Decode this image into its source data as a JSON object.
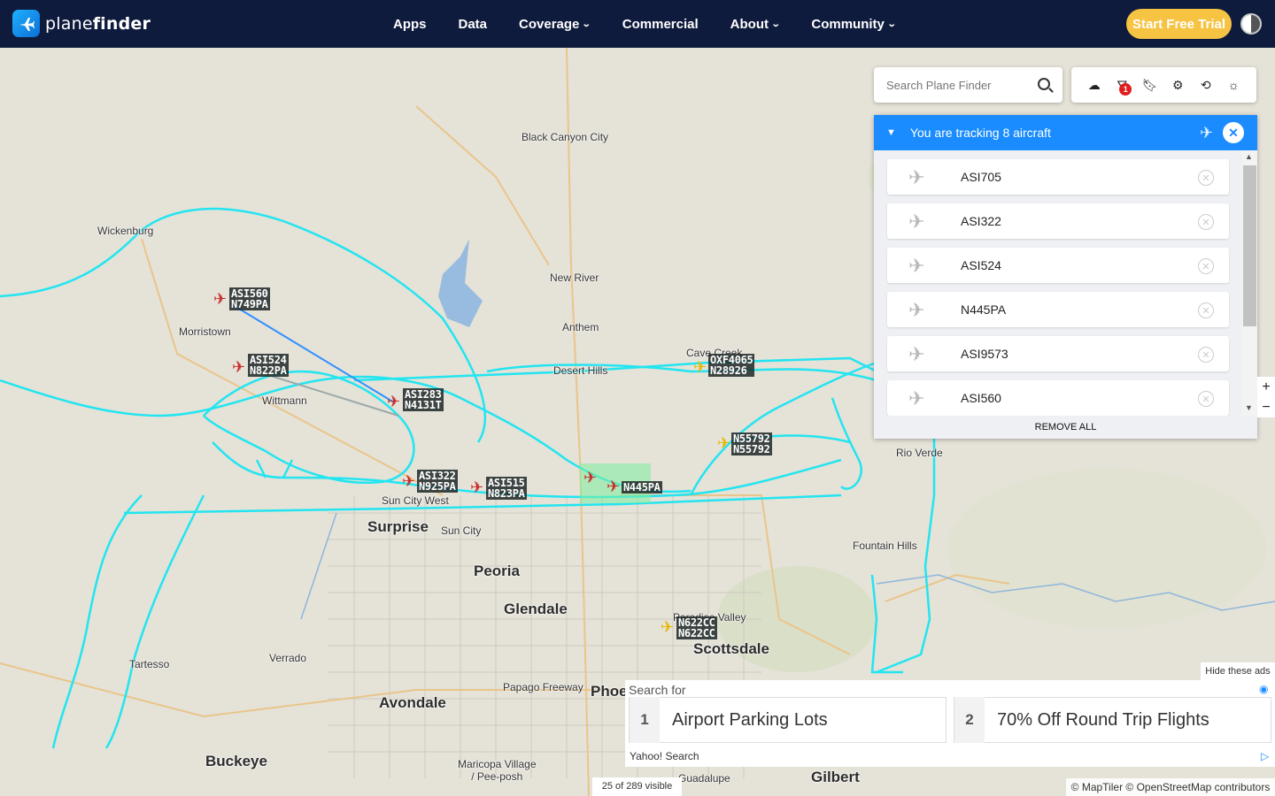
{
  "header": {
    "logo_plane": "plane",
    "logo_finder": "finder",
    "nav": [
      {
        "label": "Apps",
        "dropdown": false
      },
      {
        "label": "Data",
        "dropdown": false
      },
      {
        "label": "Coverage",
        "dropdown": true
      },
      {
        "label": "Commercial",
        "dropdown": false
      },
      {
        "label": "About",
        "dropdown": true
      },
      {
        "label": "Community",
        "dropdown": true
      }
    ],
    "cta": "Start Free Trial"
  },
  "search": {
    "placeholder": "Search Plane Finder"
  },
  "toolbar": {
    "icons": [
      "cloud-icon",
      "filter-icon",
      "bookmark-icon",
      "settings-icon",
      "history-icon",
      "weather-icon"
    ],
    "filter_badge": "1"
  },
  "tracking": {
    "title": "You are tracking 8 aircraft",
    "items": [
      "ASI705",
      "ASI322",
      "ASI524",
      "N445PA",
      "ASI9573",
      "ASI560"
    ],
    "remove_all": "REMOVE ALL"
  },
  "map": {
    "places": [
      {
        "name": "Black Canyon City",
        "type": "town"
      },
      {
        "name": "Wickenburg",
        "type": "town"
      },
      {
        "name": "New River",
        "type": "town"
      },
      {
        "name": "Anthem",
        "type": "town"
      },
      {
        "name": "Morristown",
        "type": "town"
      },
      {
        "name": "Cave Creek",
        "type": "town"
      },
      {
        "name": "Desert Hills",
        "type": "town"
      },
      {
        "name": "Rio Verde",
        "type": "town"
      },
      {
        "name": "Sun City West",
        "type": "town"
      },
      {
        "name": "Surprise",
        "type": "city"
      },
      {
        "name": "Sun City",
        "type": "town"
      },
      {
        "name": "Fountain Hills",
        "type": "town"
      },
      {
        "name": "Peoria",
        "type": "city"
      },
      {
        "name": "Glendale",
        "type": "city"
      },
      {
        "name": "Paradise Valley",
        "type": "town"
      },
      {
        "name": "Scottsdale",
        "type": "city"
      },
      {
        "name": "Tartesso",
        "type": "town"
      },
      {
        "name": "Verrado",
        "type": "town"
      },
      {
        "name": "Papago Freeway",
        "type": "town"
      },
      {
        "name": "Phoe",
        "type": "city"
      },
      {
        "name": "Avondale",
        "type": "city"
      },
      {
        "name": "Buckeye",
        "type": "city"
      },
      {
        "name": "Maricopa Village\n/ Pee-posh",
        "type": "town"
      },
      {
        "name": "Guadalupe",
        "type": "town"
      },
      {
        "name": "Gilbert",
        "type": "city"
      },
      {
        "name": "Wittmann",
        "type": "town"
      }
    ],
    "aircraft": [
      {
        "callsign": "ASI560",
        "reg": "N749PA",
        "color": "red"
      },
      {
        "callsign": "ASI524",
        "reg": "N822PA",
        "color": "red"
      },
      {
        "callsign": "ASI283",
        "reg": "N4131T",
        "color": "red"
      },
      {
        "callsign": "OXF4065",
        "reg": "N28926",
        "color": "yellow"
      },
      {
        "callsign": "N55792",
        "reg": "N55792",
        "color": "yellow"
      },
      {
        "callsign": "ASI322",
        "reg": "N925PA",
        "color": "red"
      },
      {
        "callsign": "ASI515",
        "reg": "N823PA",
        "color": "red"
      },
      {
        "callsign": "N445PA",
        "reg": "",
        "color": "red"
      },
      {
        "callsign": "N622CC",
        "reg": "N622CC",
        "color": "yellow"
      }
    ],
    "track_color": "#22e5f0",
    "zoom_in": "+",
    "zoom_out": "−"
  },
  "ad": {
    "search_for": "Search for",
    "items": [
      {
        "num": "1",
        "text": "Airport Parking Lots"
      },
      {
        "num": "2",
        "text": "70% Off Round Trip Flights"
      }
    ],
    "provider": "Yahoo! Search",
    "hide": "Hide these ads"
  },
  "footer": {
    "visible": "25 of 289 visible",
    "attribution": "© MapTiler © OpenStreetMap contributors"
  }
}
